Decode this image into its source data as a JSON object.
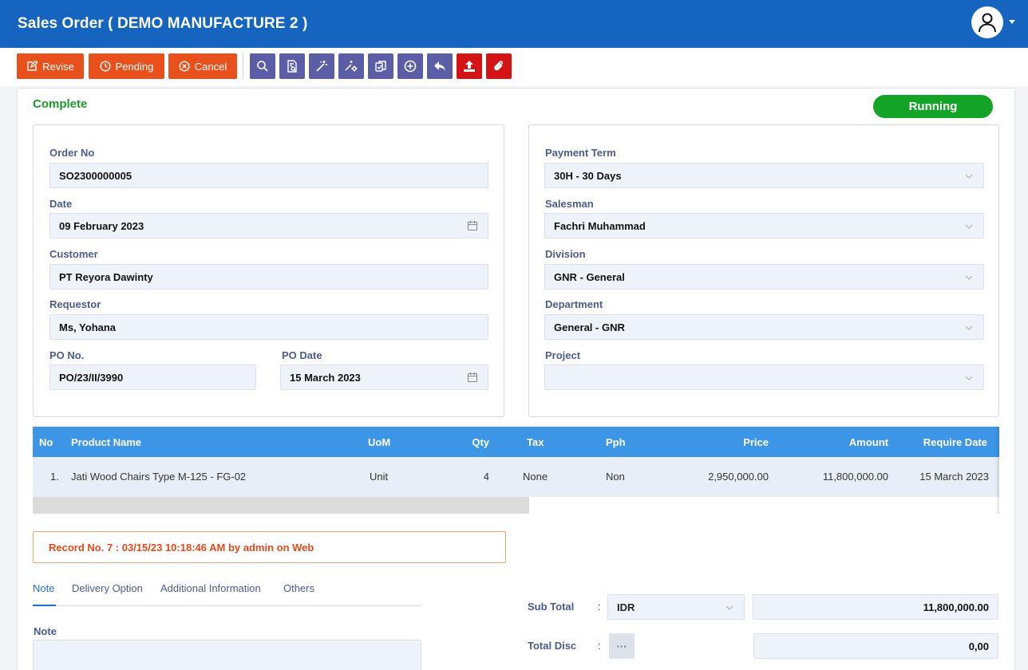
{
  "header": {
    "title": "Sales Order ( DEMO MANUFACTURE 2 )"
  },
  "toolbar": {
    "revise": "Revise",
    "pending": "Pending",
    "cancel": "Cancel"
  },
  "status": {
    "label": "Complete",
    "pill": "Running"
  },
  "left_form": {
    "order_no_label": "Order No",
    "order_no": "SO2300000005",
    "date_label": "Date",
    "date": "09 February 2023",
    "customer_label": "Customer",
    "customer": "PT Reyora Dawinty",
    "requestor_label": "Requestor",
    "requestor": "Ms, Yohana",
    "po_no_label": "PO No.",
    "po_no": "PO/23/II/3990",
    "po_date_label": "PO Date",
    "po_date": "15 March 2023"
  },
  "right_form": {
    "payment_term_label": "Payment Term",
    "payment_term": "30H - 30 Days",
    "salesman_label": "Salesman",
    "salesman": "Fachri Muhammad",
    "division_label": "Division",
    "division": "GNR - General",
    "department_label": "Department",
    "department": "General - GNR",
    "project_label": "Project",
    "project": ""
  },
  "grid": {
    "columns": [
      "No",
      "Product Name",
      "UoM",
      "Qty",
      "Tax",
      "Pph",
      "Price",
      "Amount",
      "Require Date"
    ],
    "rows": [
      {
        "no": "1.",
        "product": "Jati Wood Chairs Type M-125 - FG-02",
        "uom": "Unit",
        "qty": "4",
        "tax": "None",
        "pph": "Non",
        "price": "2,950,000.00",
        "amount": "11,800,000.00",
        "require_date": "15 March 2023"
      }
    ]
  },
  "record": "Record No. 7 : 03/15/23 10:18:46 AM by admin on Web",
  "tabs": [
    "Note",
    "Delivery Option",
    "Additional Information",
    "Others"
  ],
  "note_label": "Note",
  "totals": {
    "subtotal_label": "Sub Total",
    "currency": "IDR",
    "subtotal": "11,800,000.00",
    "total_disc_label": "Total Disc",
    "total_disc": "0,00",
    "colon": ":",
    "dots": "···"
  }
}
